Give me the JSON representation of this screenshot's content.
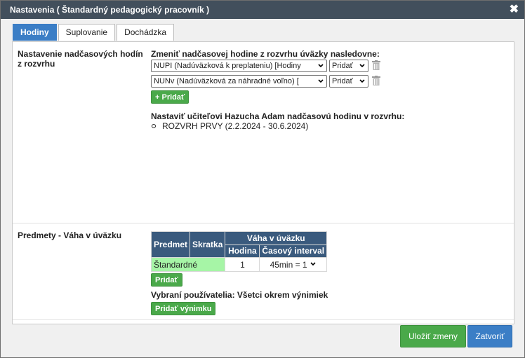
{
  "dialog": {
    "title": "Nastavenia ( Štandardný pedagogický pracovník )"
  },
  "tabs": [
    {
      "label": "Hodiny"
    },
    {
      "label": "Suplovanie"
    },
    {
      "label": "Dochádzka"
    }
  ],
  "overtime": {
    "label": "Nastavenie nadčasových hodín z rozvrhu",
    "instruction": "Zmeniť nadčasovej hodine z rozvrhu úväzky nasledovne:",
    "rows": [
      {
        "type_value": "NUPI (Nadúväzková k preplateniu) [Hodiny",
        "action_value": "Pridať"
      },
      {
        "type_value": "NUNv (Nadúväzková za náhradné voľno) [",
        "action_value": "Pridať"
      }
    ],
    "add_button": "+ Pridať",
    "assign_heading": "Nastaviť učiteľovi Hazucha Adam nadčasovú hodinu v rozvrhu:",
    "schedules": [
      "ROZVRH PRVY (2.2.2024 - 30.6.2024)"
    ]
  },
  "subjects": {
    "label": "Predmety - Váha v úväzku",
    "table": {
      "headers": {
        "subject": "Predmet",
        "abbr": "Skratka",
        "weight": "Váha v úväzku",
        "hours": "Hodina",
        "interval": "Časový interval"
      },
      "rows": [
        {
          "subject": "Štandardné",
          "abbr": "",
          "hours": "1",
          "interval": "45min = 1"
        }
      ]
    },
    "add_button": "Pridať",
    "selected_users": "Vybraní používatelia: Všetci okrem výnimiek",
    "add_exception_button": "Pridať výnimku"
  },
  "footer": {
    "save_label": "Uložiť zmeny",
    "close_label": "Zatvoriť"
  },
  "colors": {
    "titlebar": "#424f5c",
    "tab_active": "#3b7ec6",
    "green_button": "#4aa94a",
    "table_header": "#3a5a7d",
    "highlight_cell": "#a6f5a6",
    "close_button": "#3b7ec6"
  }
}
